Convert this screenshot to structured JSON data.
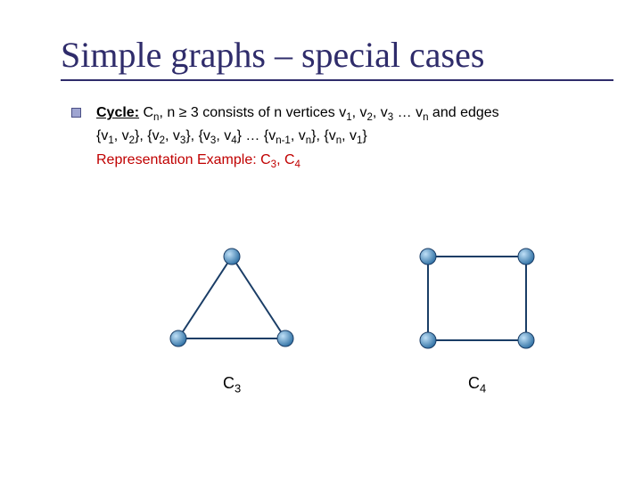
{
  "title": "Simple graphs – special cases",
  "bullet": {
    "label": "Cycle:",
    "def_prefix": " C",
    "def_sub_n": "n",
    "def_text_1": ", n ≥ 3 consists of n vertices v",
    "def_text_2": ", v",
    "def_text_3": ", v",
    "def_text_4": " … v",
    "def_text_5": " and edges",
    "sub_1": "1",
    "sub_2": "2",
    "sub_3": "3",
    "sub_n": "n",
    "edges_line_1": "{v",
    "edges_line_2": ", v",
    "edges_line_3": "}, {v",
    "edges_line_4": ", v",
    "edges_line_5": "}, {v",
    "edges_line_6": ", v",
    "edges_line_7": "} … {v",
    "edges_line_8": ", v",
    "edges_line_9": "}, {v",
    "edges_line_10": ", v",
    "edges_line_11": "}",
    "sub_4": "4",
    "sub_nm1": "n-1",
    "example_prefix": "Representation Example: C",
    "example_mid": ", C",
    "example_s1": "3",
    "example_s2": "4"
  },
  "captions": {
    "c3_label": "C",
    "c3_sub": "3",
    "c4_label": "C",
    "c4_sub": "4"
  },
  "chart_data": [
    {
      "type": "graph",
      "name": "C3",
      "vertices": 3,
      "edges": [
        [
          1,
          2
        ],
        [
          2,
          3
        ],
        [
          3,
          1
        ]
      ],
      "layout": "triangle"
    },
    {
      "type": "graph",
      "name": "C4",
      "vertices": 4,
      "edges": [
        [
          1,
          2
        ],
        [
          2,
          3
        ],
        [
          3,
          4
        ],
        [
          4,
          1
        ]
      ],
      "layout": "square"
    }
  ]
}
